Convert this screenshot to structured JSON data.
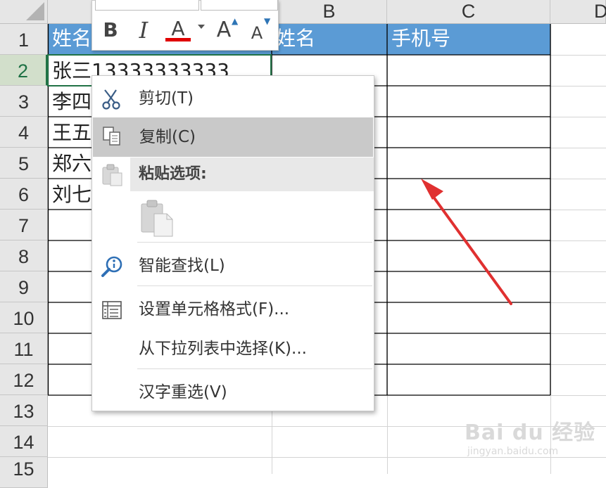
{
  "columns": [
    "B",
    "C",
    "D"
  ],
  "rows": [
    "1",
    "2",
    "3",
    "4",
    "5",
    "6",
    "7",
    "8",
    "9",
    "10",
    "11",
    "12",
    "13",
    "14",
    "15"
  ],
  "cells": {
    "a1": "姓名",
    "a2": "张三",
    "a2_overflow": "13333333333",
    "a3": "李四",
    "a4": "王五",
    "a5": "郑六",
    "a6": "刘七",
    "b1": "姓名",
    "c1": "手机号"
  },
  "minibar": {
    "bold": "B",
    "italic": "I",
    "font_color": "A",
    "grow_font": "A",
    "shrink_font": "A"
  },
  "context_menu": {
    "cut": "剪切(T)",
    "copy": "复制(C)",
    "paste_options": "粘贴选项:",
    "smart_lookup": "智能查找(L)",
    "format_cells": "设置单元格格式(F)...",
    "pick_from_list": "从下拉列表中选择(K)...",
    "reconvert": "汉字重选(V)"
  },
  "watermark": {
    "brand": "Bai du 经验",
    "url": "jingyan.baidu.com"
  },
  "colors": {
    "header_fill": "#5b9bd5",
    "selected_row_header": "#a9d08e",
    "arrow": "#e03030",
    "font_color_bar": "#e00000"
  }
}
